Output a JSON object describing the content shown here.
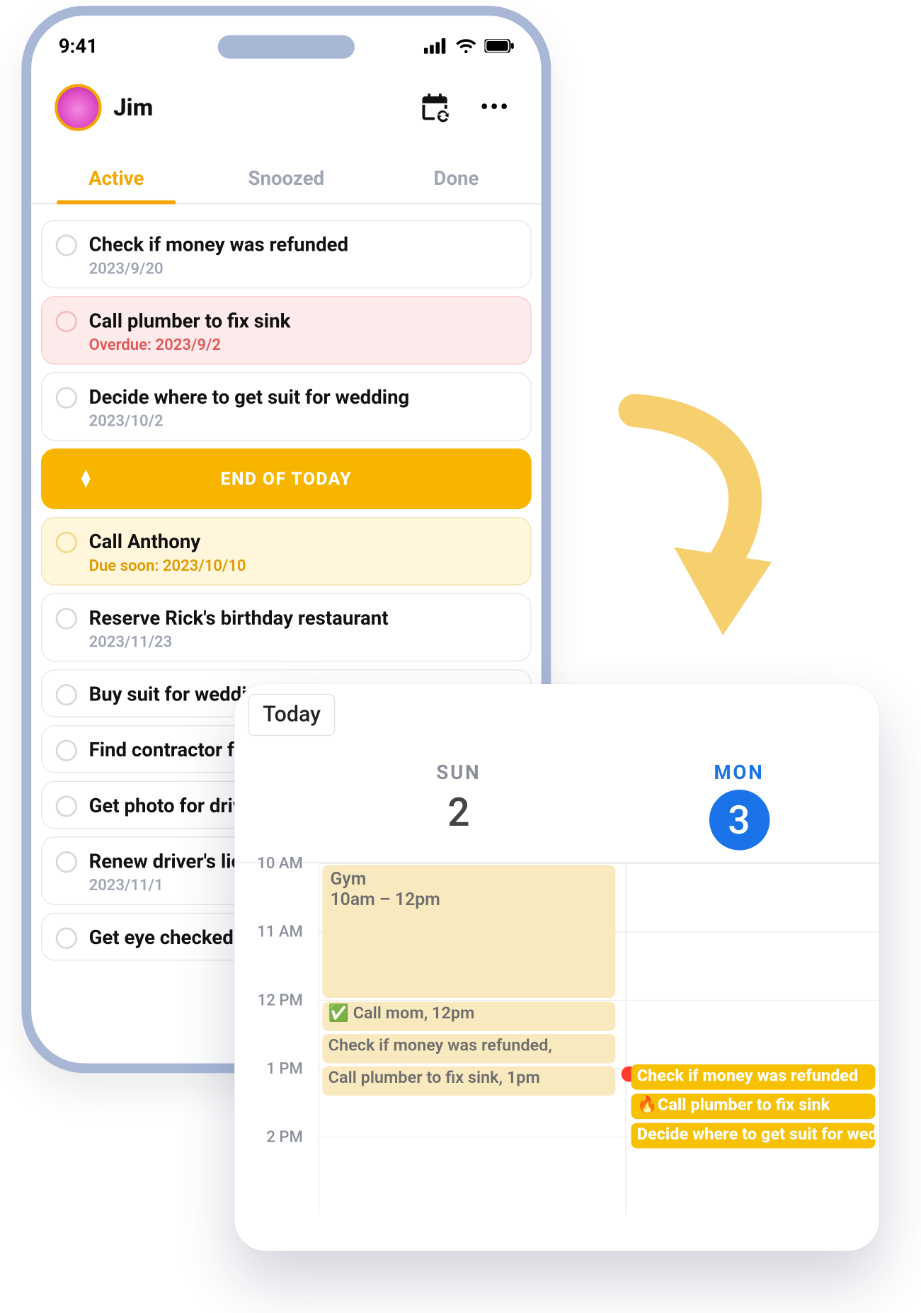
{
  "status": {
    "time": "9:41"
  },
  "header": {
    "username": "Jim"
  },
  "tabs": [
    {
      "label": "Active",
      "active": true
    },
    {
      "label": "Snoozed",
      "active": false
    },
    {
      "label": "Done",
      "active": false
    }
  ],
  "divider": {
    "label": "END OF TODAY"
  },
  "tasks": [
    {
      "title": "Check if money was refunded",
      "sub": "2023/9/20",
      "variant": "normal"
    },
    {
      "title": "Call plumber to fix sink",
      "sub": "Overdue: 2023/9/2",
      "variant": "overdue"
    },
    {
      "title": "Decide where to get suit for wedding",
      "sub": "2023/10/2",
      "variant": "normal"
    },
    {
      "title": "Call Anthony",
      "sub": "Due soon: 2023/10/10",
      "variant": "soon"
    },
    {
      "title": "Reserve Rick's birthday restaurant",
      "sub": "2023/11/23",
      "variant": "normal"
    },
    {
      "title": "Buy suit for wedding",
      "sub": "",
      "variant": "normal"
    },
    {
      "title": "Find contractor for renovation",
      "sub": "",
      "variant": "normal"
    },
    {
      "title": "Get photo for driver's license",
      "sub": "",
      "variant": "normal"
    },
    {
      "title": "Renew driver's license",
      "sub": "2023/11/1",
      "variant": "normal"
    },
    {
      "title": "Get eye checked",
      "sub": "",
      "variant": "normal"
    }
  ],
  "calendar": {
    "today_label": "Today",
    "days": [
      {
        "dow": "SUN",
        "num": "2",
        "today": false
      },
      {
        "dow": "MON",
        "num": "3",
        "today": true
      }
    ],
    "hours": [
      "10 AM",
      "11 AM",
      "12 PM",
      "1 PM",
      "2 PM"
    ],
    "events_sun": {
      "gym": {
        "title": "Gym",
        "time": "10am – 12pm"
      },
      "call_mom": "✅ Call mom, 12pm",
      "refund": "Check if money was refunded,",
      "plumber": "Call plumber to fix sink, 1pm"
    },
    "events_mon": {
      "refund": "Check if money was refunded",
      "plumber": "🔥Call plumber to fix sink",
      "suit": "Decide where to get suit for wedding"
    }
  }
}
